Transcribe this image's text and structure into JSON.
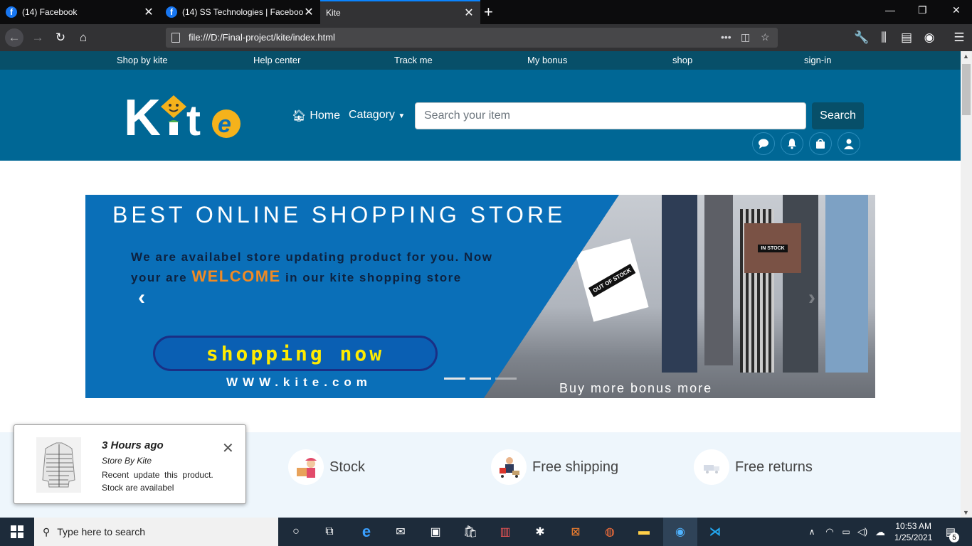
{
  "browser": {
    "tabs": [
      {
        "title": "(14) Facebook"
      },
      {
        "title": "(14) SS Technologies | Facebook"
      },
      {
        "title": "Kite"
      }
    ],
    "url": "file:///D:/Final-project/kite/index.html"
  },
  "site": {
    "top_links": [
      "Shop by kite",
      "Help center",
      "Track me",
      "My bonus",
      "shop",
      "sign-in"
    ],
    "nav": {
      "home": "Home",
      "category": "Catagory"
    },
    "search": {
      "placeholder": "Search your item",
      "button": "Search"
    },
    "logo_text": "Kite",
    "brand_colors": {
      "top_strip": "#074f69",
      "header": "#006795",
      "search_button": "#074f69"
    }
  },
  "banner": {
    "title": "BEST ONLINE SHOPPING STORE",
    "sub_line1": "We are availabel store updating product for you. Now",
    "sub_line2_pre": "your are",
    "sub_welcome": "WELCOME",
    "sub_line2_post": "in our kite shopping store",
    "cta": "shopping now",
    "url": "WWW.kite.com",
    "bonus": "Buy more bonus more",
    "bag_left": "OUT OF STOCK",
    "bag_right": "IN STOCK"
  },
  "features": [
    {
      "label": "Stock",
      "icon": "stock-icon"
    },
    {
      "label": "Free shipping",
      "icon": "shipping-icon"
    },
    {
      "label": "Free returns",
      "icon": "returns-icon"
    }
  ],
  "toast": {
    "time": "3 Hours ago",
    "store": "Store By Kite",
    "line1": "Recent  update  this  product.",
    "line2": "Stock are availabel"
  },
  "taskbar": {
    "search_placeholder": "Type here to search",
    "time": "10:53 AM",
    "date": "1/25/2021",
    "notification_count": "5"
  }
}
